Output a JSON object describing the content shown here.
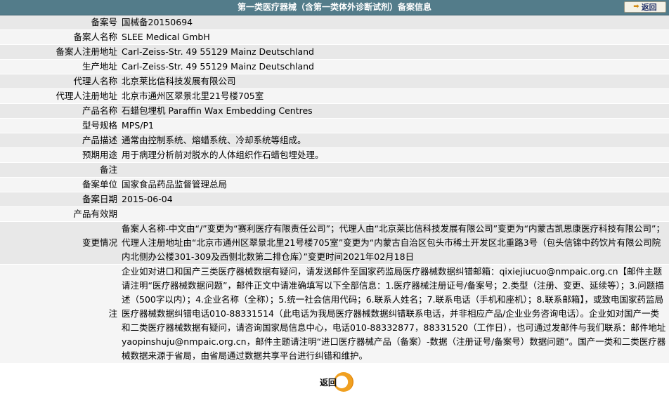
{
  "header": {
    "title": "第一类医疗器械（含第一类体外诊断试剂）备案信息",
    "back_label": "返回"
  },
  "rows": [
    {
      "label": "备案号",
      "value": "国械备20150694"
    },
    {
      "label": "备案人名称",
      "value": "SLEE Medical GmbH"
    },
    {
      "label": "备案人注册地址",
      "value": "Carl-Zeiss-Str. 49 55129 Mainz Deutschland"
    },
    {
      "label": "生产地址",
      "value": "Carl-Zeiss-Str. 49 55129 Mainz Deutschland"
    },
    {
      "label": "代理人名称",
      "value": "北京莱比信科技发展有限公司"
    },
    {
      "label": "代理人注册地址",
      "value": "北京市通州区翠景北里21号楼705室"
    },
    {
      "label": "产品名称",
      "value": "石蜡包埋机 Paraffin Wax Embedding Centres"
    },
    {
      "label": "型号规格",
      "value": "MPS/P1"
    },
    {
      "label": "产品描述",
      "value": "通常由控制系统、熔蜡系统、冷却系统等组成。"
    },
    {
      "label": "预期用途",
      "value": "用于病理分析前对脱水的人体组织作石蜡包埋处理。"
    },
    {
      "label": "备注",
      "value": ""
    },
    {
      "label": "备案单位",
      "value": "国家食品药品监督管理总局"
    },
    {
      "label": "备案日期",
      "value": "2015-06-04"
    },
    {
      "label": "产品有效期",
      "value": ""
    },
    {
      "label": "变更情况",
      "value": "备案人名称-中文由“/”变更为“赛利医疗有限责任公司”；代理人由“北京莱比信科技发展有限公司”变更为“内蒙古凯思康医疗科技有限公司”；代理人注册地址由“北京市通州区翠景北里21号楼705室”变更为“内蒙古自治区包头市稀土开发区北重路3号（包头信锦中药饮片有限公司院内北侧办公楼301-309及西侧北数第二排仓库）”变更时间2021年02月18日"
    },
    {
      "label": "注",
      "value": "企业如对进口和国产三类医疗器械数据有疑问，请发送邮件至国家药监局医疗器械数据纠错邮箱：qixiejiucuo@nmpaic.org.cn【邮件主题请注明“医疗器械数据问题”，邮件正文中请准确填写以下全部信息：1.医疗器械注册证号/备案号；2.类型（注册、变更、延续等）；3.问题描述（500字以内）；4.企业名称（全称）；5.统一社会信用代码；6.联系人姓名；7.联系电话（手机和座机）；8.联系邮箱】，或致电国家药监局医疗器械数据纠错电话010-88331514（此电话为我局医疗器械数据纠错联系电话，并非相应产品/企业业务咨询电话）。企业如对国产一类和二类医疗器械数据有疑问，请咨询国家局信息中心，电话010-88332877，88331520（工作日），也可通过发邮件与我们联系：邮件地址yaopinshuju@nmpaic.org.cn，邮件主题请注明“进口医疗器械产品（备案）-数据（注册证号/备案号）数据问题”。国产一类和二类医疗器械数据来源于省局，由省局通过数据共享平台进行纠错和维护。"
    }
  ],
  "footer": {
    "back_label": "返回"
  }
}
